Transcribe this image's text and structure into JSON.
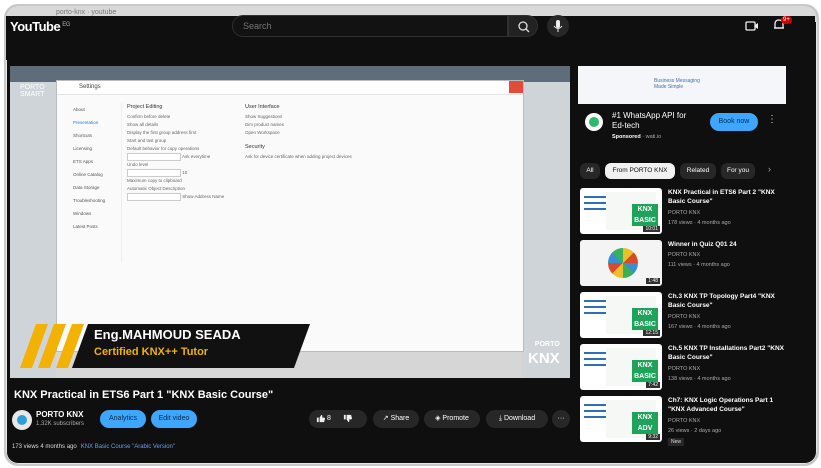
{
  "browser": {
    "tab_title": "porto-knx · youtube"
  },
  "header": {
    "logo": "YouTube",
    "logo_country": "EG",
    "search_placeholder": "Search",
    "notif_count": "9+"
  },
  "player": {
    "ets_window": {
      "title": "Settings",
      "sidebar": [
        "About",
        "Presentation",
        "Shortcuts",
        "Licensing",
        "ETS Apps",
        "Online Catalog",
        "Data Storage",
        "Troubleshooting",
        "Windows",
        "Latest Posts"
      ],
      "col1_heading": "Project Editing",
      "col1_lines": [
        "Confirm before delete",
        "Show all details",
        "Display the first group address first",
        "Start and last group",
        "Default behavior for copy operations",
        "Ask everytime",
        "Undo level",
        "10",
        "Maximum copy to clipboard",
        "Automatic Object Description",
        "Show Address Name"
      ],
      "col2_heading": "User Interface",
      "col2_lines": [
        "Show Suggestions",
        "Dim product names",
        "Open Workspace",
        "Security",
        "Ask for device certificate when adding project devices"
      ]
    },
    "watermark": {
      "line1": "PORTO",
      "line2": "SMART"
    },
    "lower_third": {
      "name": "Eng.MAHMOUD SEADA",
      "title": "Certified KNX++ Tutor"
    },
    "corner_logo": {
      "top": "PORTO",
      "bottom": "KNX"
    }
  },
  "video": {
    "title": "KNX Practical in ETS6 Part 1 \"KNX Basic Course\"",
    "channel": "PORTO KNX",
    "subscribers": "1.32K subscribers",
    "analytics_label": "Analytics",
    "edit_label": "Edit video",
    "likes": "8",
    "share_label": "Share",
    "promote_label": "Promote",
    "download_label": "Download",
    "more_label": "···",
    "views_time": "173 views  4 months ago",
    "hashtags": "KNX Basic Course \"Arabic Version\""
  },
  "ad": {
    "banner_line1": "Business Messaging",
    "banner_line2": "Made Simple",
    "title": "#1 WhatsApp API for Ed-tech",
    "sponsored": "Sponsored",
    "domain": "wati.io",
    "cta": "Book now"
  },
  "chips": [
    "All",
    "From PORTO KNX",
    "Related",
    "For you"
  ],
  "recommendations": [
    {
      "title": "KNX Practical in ETS6 Part 2 \"KNX Basic Course\"",
      "channel": "PORTO KNX",
      "stats": "178 views · 4 months ago",
      "duration": "10:01"
    },
    {
      "title": "Winner in Quiz Q01 24",
      "channel": "PORTO KNX",
      "stats": "111 views · 4 months ago",
      "duration": "1:48"
    },
    {
      "title": "Ch.3 KNX TP Topology Part4 \"KNX Basic Course\"",
      "channel": "PORTO KNX",
      "stats": "167 views · 4 months ago",
      "duration": "12:15"
    },
    {
      "title": "Ch.5 KNX TP Installations Part2 \"KNX Basic Course\"",
      "channel": "PORTO KNX",
      "stats": "138 views · 4 months ago",
      "duration": "7:42"
    },
    {
      "title": "Ch7: KNX Logic Operations Part 1 \"KNX Advanced Course\"",
      "channel": "PORTO KNX",
      "stats": "26 views · 2 days ago",
      "duration": "9:32",
      "badge": "New"
    }
  ]
}
